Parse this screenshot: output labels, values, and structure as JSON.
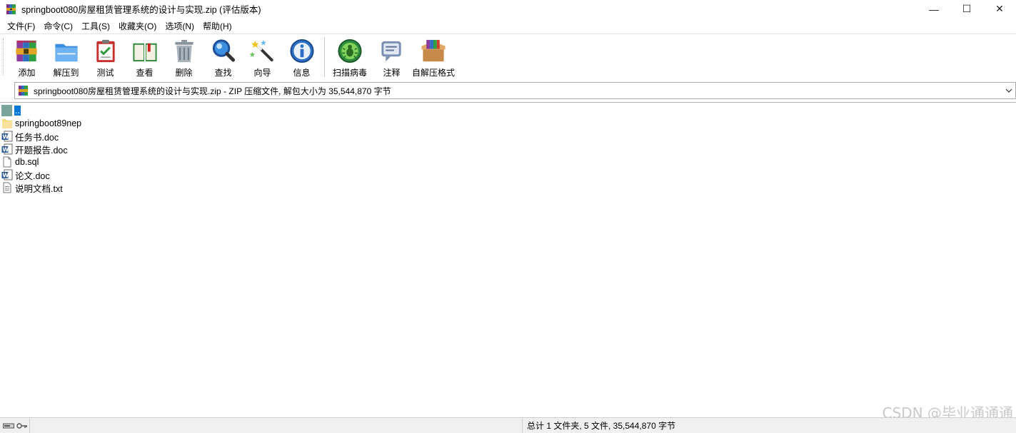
{
  "window": {
    "title": "springboot080房屋租赁管理系统的设计与实现.zip (评估版本)",
    "controls": {
      "minimize": "—",
      "maximize": "☐",
      "close": "✕"
    }
  },
  "menu": [
    {
      "label": "文件(F)"
    },
    {
      "label": "命令(C)"
    },
    {
      "label": "工具(S)"
    },
    {
      "label": "收藏夹(O)"
    },
    {
      "label": "选项(N)"
    },
    {
      "label": "帮助(H)"
    }
  ],
  "toolbar": {
    "add": "添加",
    "extract_to": "解压到",
    "test": "测试",
    "view": "查看",
    "delete": "删除",
    "find": "查找",
    "wizard": "向导",
    "info": "信息",
    "virus_scan": "扫描病毒",
    "comment": "注释",
    "sfx": "自解压格式"
  },
  "address": {
    "text": "springboot080房屋租赁管理系统的设计与实现.zip - ZIP 压缩文件, 解包大小为 35,544,870 字节"
  },
  "files": [
    {
      "name": "..",
      "icon": "parent-folder-icon"
    },
    {
      "name": "springboot89nep",
      "icon": "folder-icon"
    },
    {
      "name": "任务书.doc",
      "icon": "word-doc-icon"
    },
    {
      "name": "开题报告.doc",
      "icon": "word-doc-icon"
    },
    {
      "name": "db.sql",
      "icon": "blank-file-icon"
    },
    {
      "name": "论文.doc",
      "icon": "word-doc-icon"
    },
    {
      "name": "说明文档.txt",
      "icon": "text-file-icon"
    }
  ],
  "status": {
    "summary": "总计 1 文件夹, 5 文件, 35,544,870 字节"
  },
  "watermark": "CSDN @毕业通通通",
  "colors": {
    "selection": "#0078d7",
    "statusbar_bg": "#f0f0f0"
  }
}
